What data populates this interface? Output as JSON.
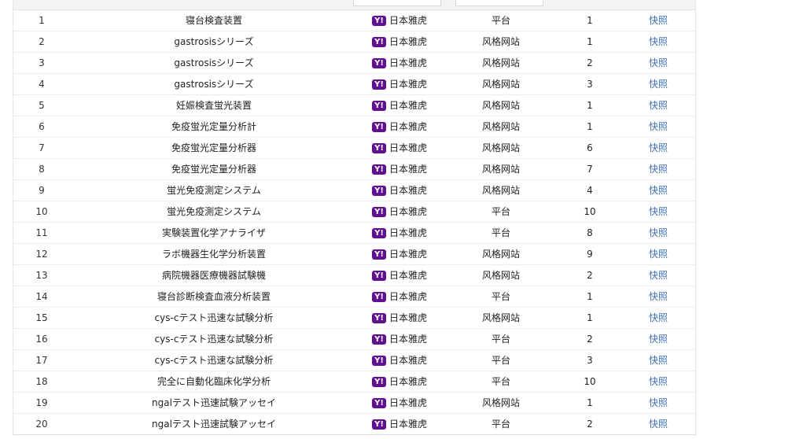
{
  "table": {
    "tabs": [
      "",
      ""
    ],
    "engine_icon": "yahoo-icon",
    "rows": [
      {
        "idx": "1",
        "keyword": "寝台検査装置",
        "engine": "日本雅虎",
        "type": "平台",
        "rank": "1",
        "snapshot": "快照"
      },
      {
        "idx": "2",
        "keyword": "gastrosisシリーズ",
        "engine": "日本雅虎",
        "type": "风格网站",
        "rank": "1",
        "snapshot": "快照"
      },
      {
        "idx": "3",
        "keyword": "gastrosisシリーズ",
        "engine": "日本雅虎",
        "type": "风格网站",
        "rank": "2",
        "snapshot": "快照"
      },
      {
        "idx": "4",
        "keyword": "gastrosisシリーズ",
        "engine": "日本雅虎",
        "type": "风格网站",
        "rank": "3",
        "snapshot": "快照"
      },
      {
        "idx": "5",
        "keyword": "妊娠検査蛍光装置",
        "engine": "日本雅虎",
        "type": "风格网站",
        "rank": "1",
        "snapshot": "快照"
      },
      {
        "idx": "6",
        "keyword": "免疫蛍光定量分析計",
        "engine": "日本雅虎",
        "type": "风格网站",
        "rank": "1",
        "snapshot": "快照"
      },
      {
        "idx": "7",
        "keyword": "免疫蛍光定量分析器",
        "engine": "日本雅虎",
        "type": "风格网站",
        "rank": "6",
        "snapshot": "快照"
      },
      {
        "idx": "8",
        "keyword": "免疫蛍光定量分析器",
        "engine": "日本雅虎",
        "type": "风格网站",
        "rank": "7",
        "snapshot": "快照"
      },
      {
        "idx": "9",
        "keyword": "蛍光免疫測定システム",
        "engine": "日本雅虎",
        "type": "风格网站",
        "rank": "4",
        "snapshot": "快照"
      },
      {
        "idx": "10",
        "keyword": "蛍光免疫測定システム",
        "engine": "日本雅虎",
        "type": "平台",
        "rank": "10",
        "snapshot": "快照"
      },
      {
        "idx": "11",
        "keyword": "実験装置化学アナライザ",
        "engine": "日本雅虎",
        "type": "平台",
        "rank": "8",
        "snapshot": "快照"
      },
      {
        "idx": "12",
        "keyword": "ラボ機器生化学分析装置",
        "engine": "日本雅虎",
        "type": "风格网站",
        "rank": "9",
        "snapshot": "快照"
      },
      {
        "idx": "13",
        "keyword": "病院機器医療機器試験機",
        "engine": "日本雅虎",
        "type": "风格网站",
        "rank": "2",
        "snapshot": "快照"
      },
      {
        "idx": "14",
        "keyword": "寝台診断検査血液分析装置",
        "engine": "日本雅虎",
        "type": "平台",
        "rank": "1",
        "snapshot": "快照"
      },
      {
        "idx": "15",
        "keyword": "cys-cテスト迅速な試験分析",
        "engine": "日本雅虎",
        "type": "风格网站",
        "rank": "1",
        "snapshot": "快照"
      },
      {
        "idx": "16",
        "keyword": "cys-cテスト迅速な試験分析",
        "engine": "日本雅虎",
        "type": "平台",
        "rank": "2",
        "snapshot": "快照"
      },
      {
        "idx": "17",
        "keyword": "cys-cテスト迅速な試験分析",
        "engine": "日本雅虎",
        "type": "平台",
        "rank": "3",
        "snapshot": "快照"
      },
      {
        "idx": "18",
        "keyword": "完全に自動化臨床化学分析",
        "engine": "日本雅虎",
        "type": "平台",
        "rank": "10",
        "snapshot": "快照"
      },
      {
        "idx": "19",
        "keyword": "ngalテスト迅速試験アッセイ",
        "engine": "日本雅虎",
        "type": "风格网站",
        "rank": "1",
        "snapshot": "快照"
      },
      {
        "idx": "20",
        "keyword": "ngalテスト迅速試験アッセイ",
        "engine": "日本雅虎",
        "type": "平台",
        "rank": "2",
        "snapshot": "快照"
      }
    ]
  },
  "colors": {
    "link": "#3f6fb0",
    "yahoo_purple": "#5f0f8f"
  }
}
